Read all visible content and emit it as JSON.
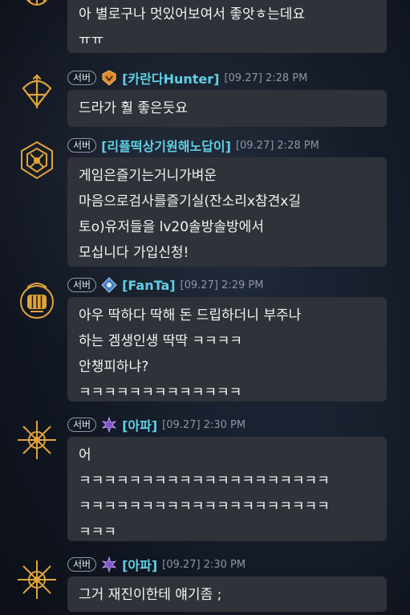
{
  "colors": {
    "name": "#5fd0e6",
    "bubble_bg": "#2f3238",
    "time": "#8d96a3",
    "badge_border": "#8f9aa8",
    "emblem_gold": "#e0a43a",
    "text": "#f2f3f5"
  },
  "messages": [
    {
      "avatar_icon": "class-emblem-icon",
      "lines": [
        "아 별로구나 멋있어보여서 좋앗ㅎ는데요",
        "ㅠㅠ"
      ]
    },
    {
      "badge": "서버",
      "class_icon": "guild-crest-orange-icon",
      "name": "[카란다Hunter]",
      "time": "[09.27] 2:28 PM",
      "avatar_icon": "bow-emblem-icon",
      "lines": [
        "드라가 훨 좋은듯요"
      ]
    },
    {
      "badge": "서버",
      "name": "[리플떡상기원해노답이]",
      "time": "[09.27] 2:28 PM",
      "avatar_icon": "shield-emblem-icon",
      "lines": [
        "게임은즐기는거니가벼운",
        "마음으로검사를즐기실(잔소리x참견x길",
        "토o)유저들을 lv20솔방솔방에서",
        "모십니다 가입신청!"
      ]
    },
    {
      "badge": "서버",
      "class_icon": "guild-crest-blue-icon",
      "name": "[FanTa]",
      "time": "[09.27] 2:29 PM",
      "avatar_icon": "fist-emblem-icon",
      "lines": [
        "아우 딱하다 딱해 돈 드립하더니 부주나",
        "하는 겜생인생 딱딱 ㅋㅋㅋㅋ",
        "안챙피하냐?",
        "ㅋㅋㅋㅋㅋㅋㅋㅋㅋㅋㅋㅋㅋ"
      ]
    },
    {
      "badge": "서버",
      "class_icon": "guild-crest-purple-icon",
      "name": "[아파]",
      "time": "[09.27] 2:30 PM",
      "avatar_icon": "star-emblem-icon",
      "lines": [
        "어",
        "ㅋㅋㅋㅋㅋㅋㅋㅋㅋㅋㅋㅋㅋㅋㅋㅋㅋㅋㅋㅋ",
        "ㅋㅋㅋㅋㅋㅋㅋㅋㅋㅋㅋㅋㅋㅋㅋㅋㅋㅋㅋㅋ",
        "ㅋㅋㅋ"
      ]
    },
    {
      "badge": "서버",
      "class_icon": "guild-crest-purple-icon",
      "name": "[아파]",
      "time": "[09.27] 2:30 PM",
      "avatar_icon": "star-emblem-icon",
      "lines": [
        "그거 재진이한테 얘기좀 ;"
      ]
    }
  ]
}
